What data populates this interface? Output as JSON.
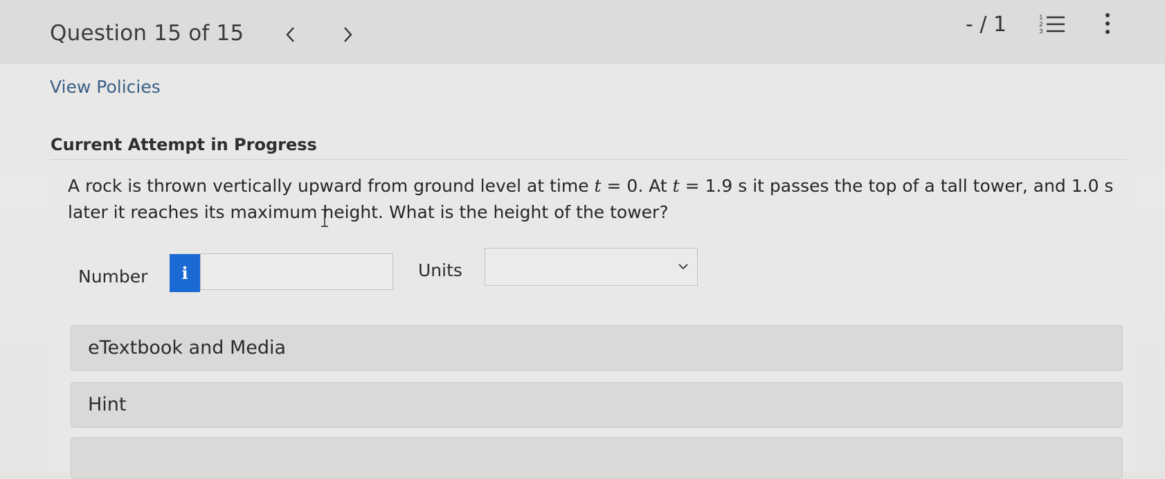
{
  "header": {
    "title": "Question 15 of 15",
    "prev_label": "<",
    "next_label": ">",
    "score": "- / 1"
  },
  "view_policies": "View Policies",
  "attempt_heading": "Current Attempt in Progress",
  "question": {
    "text_1": "A rock is thrown vertically upward from ground level at time ",
    "var_t": "t",
    "text_2": " = 0. At ",
    "text_3": " = 1.9 s it passes the top of a tall tower, and 1.0 s later it reaches its maximum height. What is the height of the tower?"
  },
  "answer": {
    "number_label": "Number",
    "info_label": "i",
    "number_value": "",
    "units_label": "Units",
    "units_value": ""
  },
  "accordions": [
    {
      "label": "eTextbook and Media"
    },
    {
      "label": "Hint"
    },
    {
      "label": ""
    }
  ],
  "colors": {
    "info_button": "#1b6ad3",
    "link": "#3a5f86"
  }
}
